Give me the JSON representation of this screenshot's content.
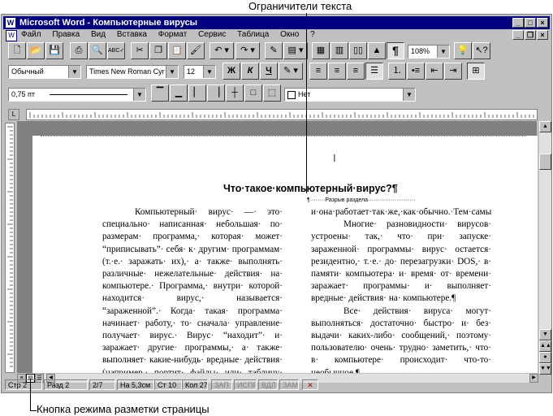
{
  "annotations": {
    "top": "Ограничители текста",
    "bottom": "Кнопка режима разметки страницы"
  },
  "window": {
    "title": "Microsoft Word - Компьютерные вирусы",
    "menu": [
      "Файл",
      "Правка",
      "Вид",
      "Вставка",
      "Формат",
      "Сервис",
      "Таблица",
      "Окно",
      "?"
    ]
  },
  "toolbar": {
    "zoom": "108%",
    "style": "Обычный",
    "font": "Times New Roman Cyr",
    "size": "12",
    "bold": "Ж",
    "italic": "К",
    "underline": "Ч",
    "pilcrow": "¶"
  },
  "borders": {
    "line_width": "0,75 пт",
    "shading": "Нет"
  },
  "document": {
    "heading": "Что·такое·компьютерный·вирус?¶",
    "section_break": "Разрыв раздела",
    "left_column": [
      "Компьютерный· вирус· —· это· специально· написанная· небольшая· по· размерам· программа,· которая· может· “приписывать”· себя· к· другим· программам· (т.·е.· заражать· их),· а· также· выполнять· различные· нежелательные· действия· на· компьютере.· Программа,· внутри· которой· находится· вирус,· называется· “зараженной”.· Когда· такая· программа· начинает· работу,· то· сначала· управление· получает· вирус.· Вирус· “находит”· и· заражает· другие· программы,· а· также· выполняет· какие-нибудь· вредные· действия· (например,· портит· файлы· или· таблицу· размещения· файлов· на· диске,· засоряет· оперативную· память· и· т.·д.),· для· маскировки· вируса· действия· по· заражению·"
    ],
    "right_column": [
      "и·она·работает·так·же,·как·обычно.·Тем·самым·внешне·работа·зараженной·программы·выглядит·так·же,·как·и·незараженной.¶",
      "Многие· разновидности· вирусов· устроены· так,· что· при· запуске· зараженной· программы· вирус· остается· резидентно,· т.·е.· до· перезагрузки· DOS,· в· памяти· компьютера· и· время· от· времени· заражает· программы· и· выполняет· вредные· действия· на· компьютере.¶",
      "Все· действия· вируса· могут· выполняться· достаточно· быстро· и· без· выдачи· каких-либо· сообщений,· поэтому· пользователю· очень· трудно· заметить,· что· в· компьютере· происходит· что-то· необычное.¶"
    ]
  },
  "status": {
    "page": "Стр 2",
    "section": "Разд 2",
    "pages": "2/7",
    "position": "На 5,3см",
    "line": "Ст 10",
    "column": "Кол 27",
    "zap": "ЗАП",
    "ispr": "ИСПР",
    "vdl": "ВДЛ",
    "zam": "ЗАМ"
  }
}
